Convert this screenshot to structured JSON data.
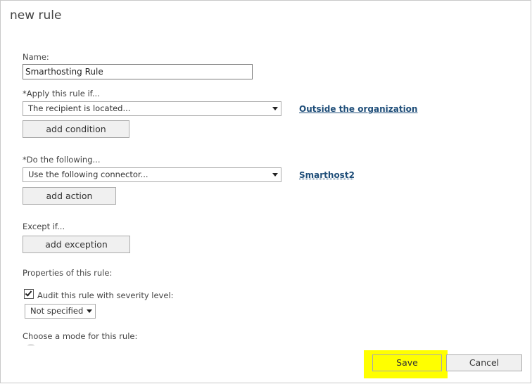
{
  "dialog": {
    "title": "new rule",
    "name_label": "Name:",
    "name_value": "Smarthosting Rule",
    "apply_label": "*Apply this rule if...",
    "apply_select": "The recipient is located...",
    "apply_link": "Outside the organization",
    "add_condition": "add condition",
    "do_label": "*Do the following...",
    "do_select": "Use the following connector...",
    "do_link": "Smarthost2",
    "add_action": "add action",
    "except_label": "Except if...",
    "add_exception": "add exception",
    "properties_label": "Properties of this rule:",
    "audit_label": "Audit this rule with severity level:",
    "audit_checked": true,
    "severity_select": "Not specified",
    "mode_label": "Choose a mode for this rule:"
  },
  "footer": {
    "save": "Save",
    "cancel": "Cancel"
  },
  "colors": {
    "highlight": "#ffff00",
    "link": "#1f4e79"
  }
}
